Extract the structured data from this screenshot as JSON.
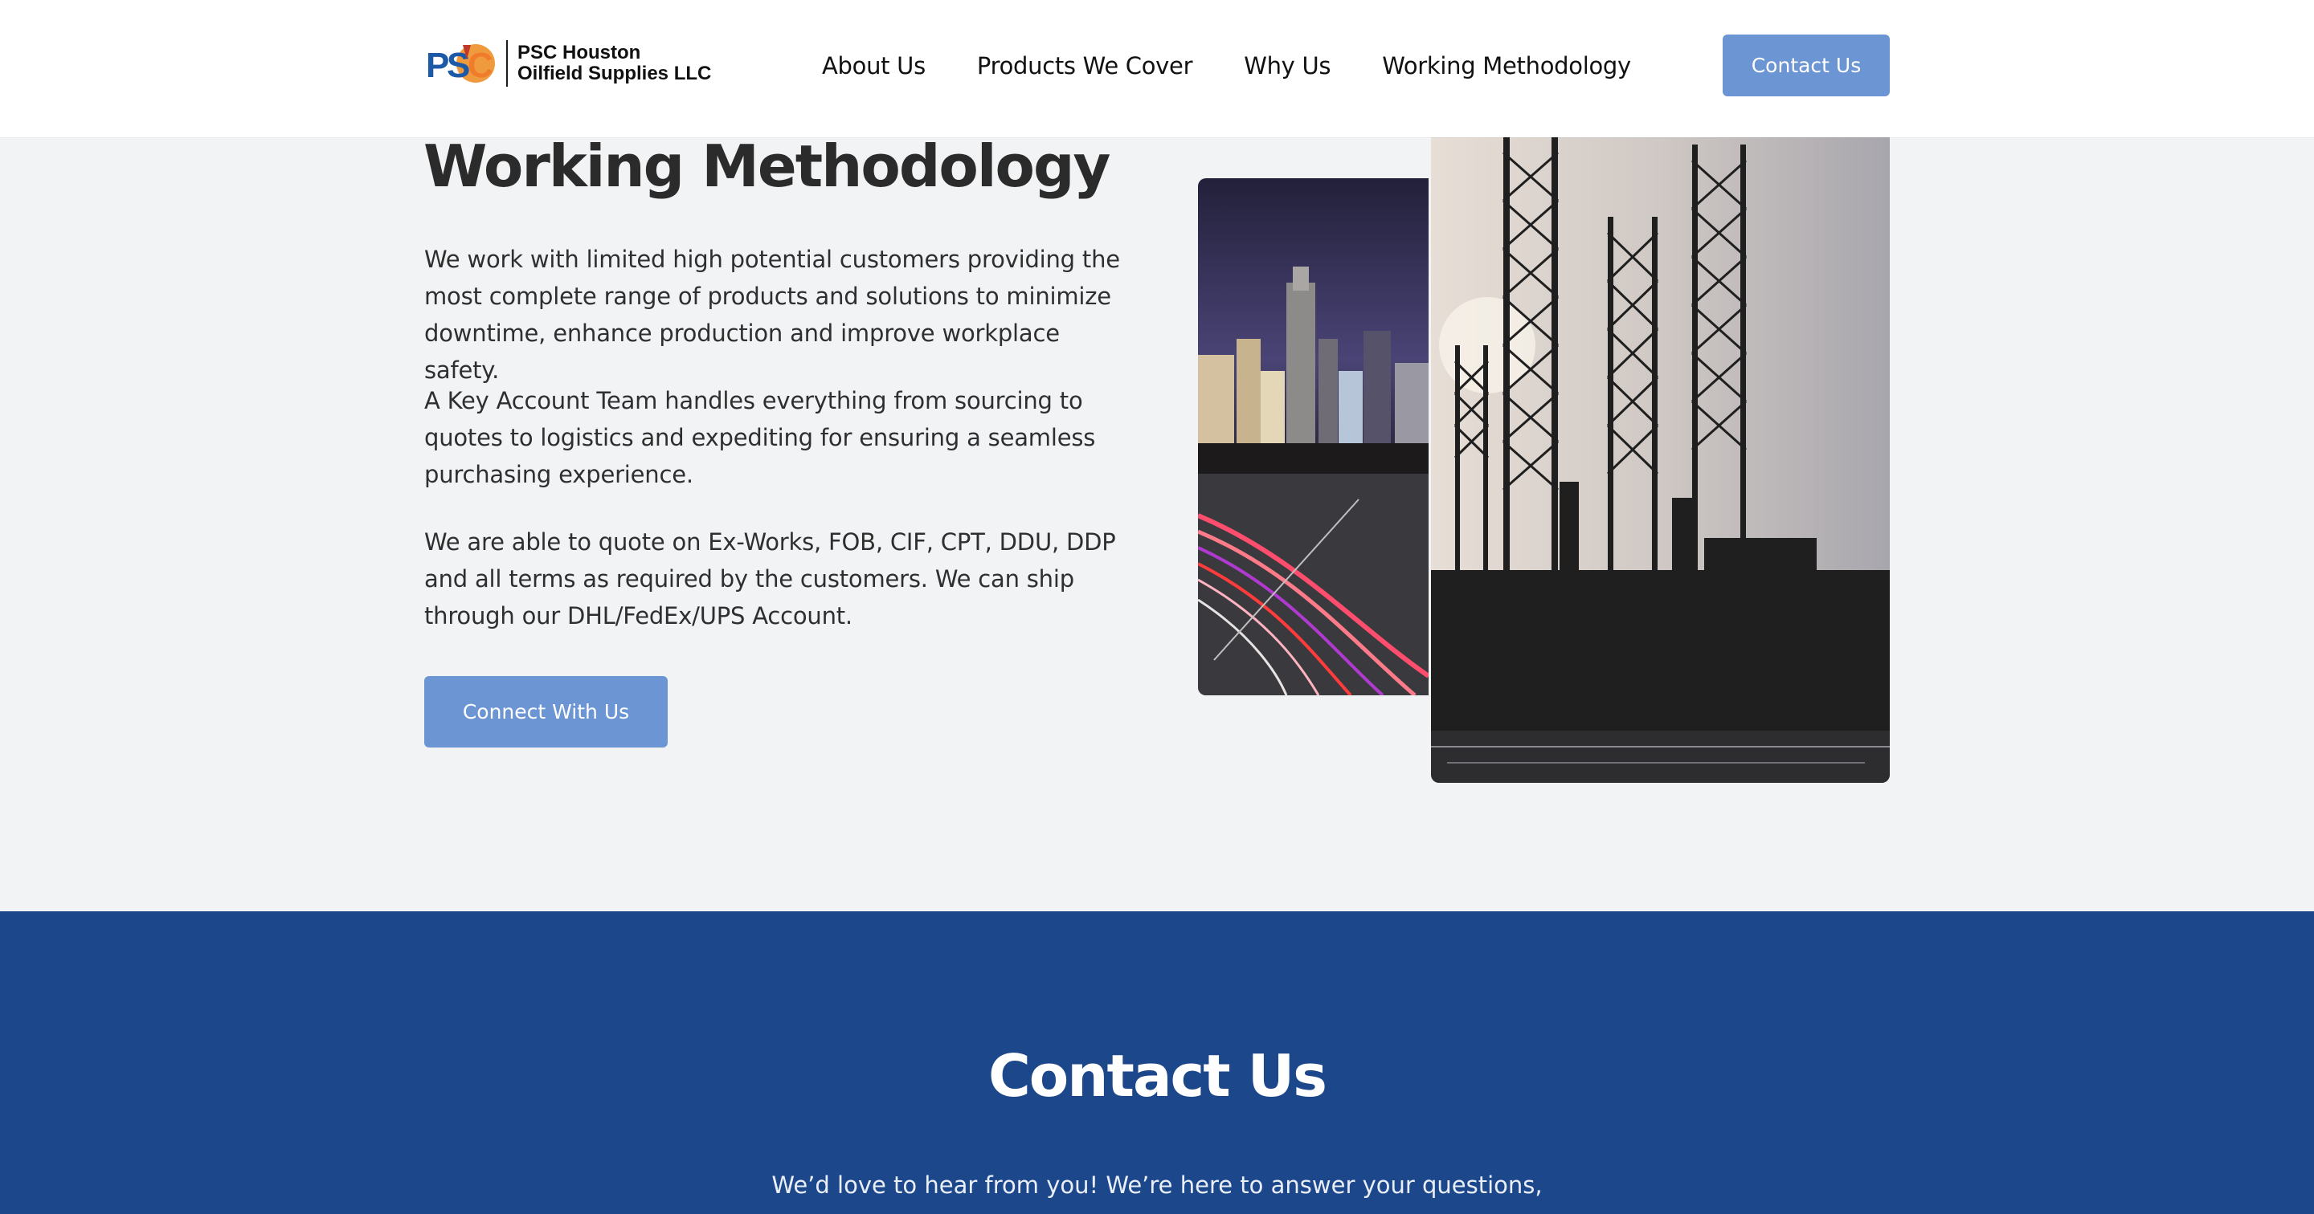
{
  "brand": {
    "line1": "PSC Houston",
    "line2": "Oilfield Supplies LLC",
    "logo_text": "PSC"
  },
  "nav": {
    "items": [
      {
        "label": "About Us"
      },
      {
        "label": "Products We Cover"
      },
      {
        "label": "Why Us"
      },
      {
        "label": "Working Methodology"
      }
    ],
    "cta_label": "Contact Us"
  },
  "methodology": {
    "title": "Working Methodology",
    "paragraphs": [
      "We work with limited high potential customers providing the most complete range of products and solutions to minimize downtime, enhance production and improve workplace safety.",
      "A Key Account Team handles everything from sourcing to quotes to logistics and expediting for ensuring a seamless purchasing experience.",
      "We are able to quote on Ex-Works, FOB, CIF, CPT, DDU, DDP and all terms as required by the customers. We can ship through our DHL/FedEx/UPS Account."
    ],
    "button_label": "Connect With Us",
    "images": [
      "city-skyline-night-traffic",
      "offshore-oil-rigs-silhouette"
    ]
  },
  "contact": {
    "title": "Contact Us",
    "subtitle": "We’d love to hear from you! We’re here to answer your questions,"
  },
  "colors": {
    "accent": "#6c95d3",
    "contact_bg": "#1c478a",
    "page_bg": "#f2f3f5",
    "header_bg": "#ffffff"
  }
}
